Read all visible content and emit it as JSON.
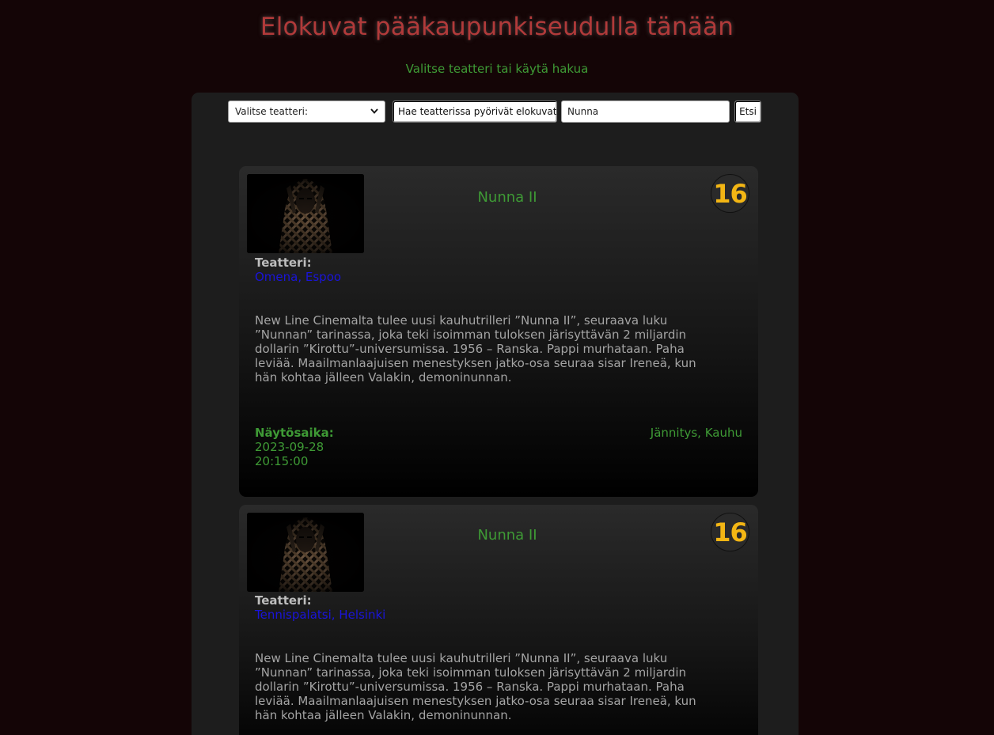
{
  "header": {
    "title": "Elokuvat pääkaupunkiseudulla tänään",
    "subtitle": "Valitse teatteri tai käytä hakua"
  },
  "controls": {
    "theater_select_value": "Valitse teatteri:",
    "search_theater_button": "Hae teatterissa pyörivät elokuvat",
    "search_input_value": "Nunna",
    "search_button": "Etsi"
  },
  "colors": {
    "background": "#140506",
    "title": "#b13a3a",
    "accent_green": "#3e9a35",
    "link_blue": "#1a14d9",
    "age_badge": "#f3b614",
    "panel": "#1d1d1d"
  },
  "labels": {
    "theater": "Teatteri:",
    "showtime": "Näytösaika:"
  },
  "movies": [
    {
      "title": "Nunna II",
      "age_rating": "16",
      "theater": "Omena, Espoo",
      "description": "New Line Cinemalta tulee uusi kauhutrilleri ”Nunna II”, seuraava luku ”Nunnan” tarinassa, joka teki isoimman tuloksen järisyttävän 2 miljardin dollarin ”Kirottu”-universumissa. 1956 – Ranska. Pappi murhataan. Paha leviää. Maailmanlaajuisen menestyksen jatko-osa seuraa sisar Ireneä, kun hän kohtaa jälleen Valakin, demoninunnan.",
      "date": "2023-09-28",
      "time": "20:15:00",
      "genres": "Jännitys, Kauhu"
    },
    {
      "title": "Nunna II",
      "age_rating": "16",
      "theater": "Tennispalatsi, Helsinki",
      "description": "New Line Cinemalta tulee uusi kauhutrilleri ”Nunna II”, seuraava luku ”Nunnan” tarinassa, joka teki isoimman tuloksen järisyttävän 2 miljardin dollarin ”Kirottu”-universumissa. 1956 – Ranska. Pappi murhataan. Paha leviää. Maailmanlaajuisen menestyksen jatko-osa seuraa sisar Ireneä, kun hän kohtaa jälleen Valakin, demoninunnan.",
      "date": "",
      "time": "",
      "genres": ""
    }
  ]
}
